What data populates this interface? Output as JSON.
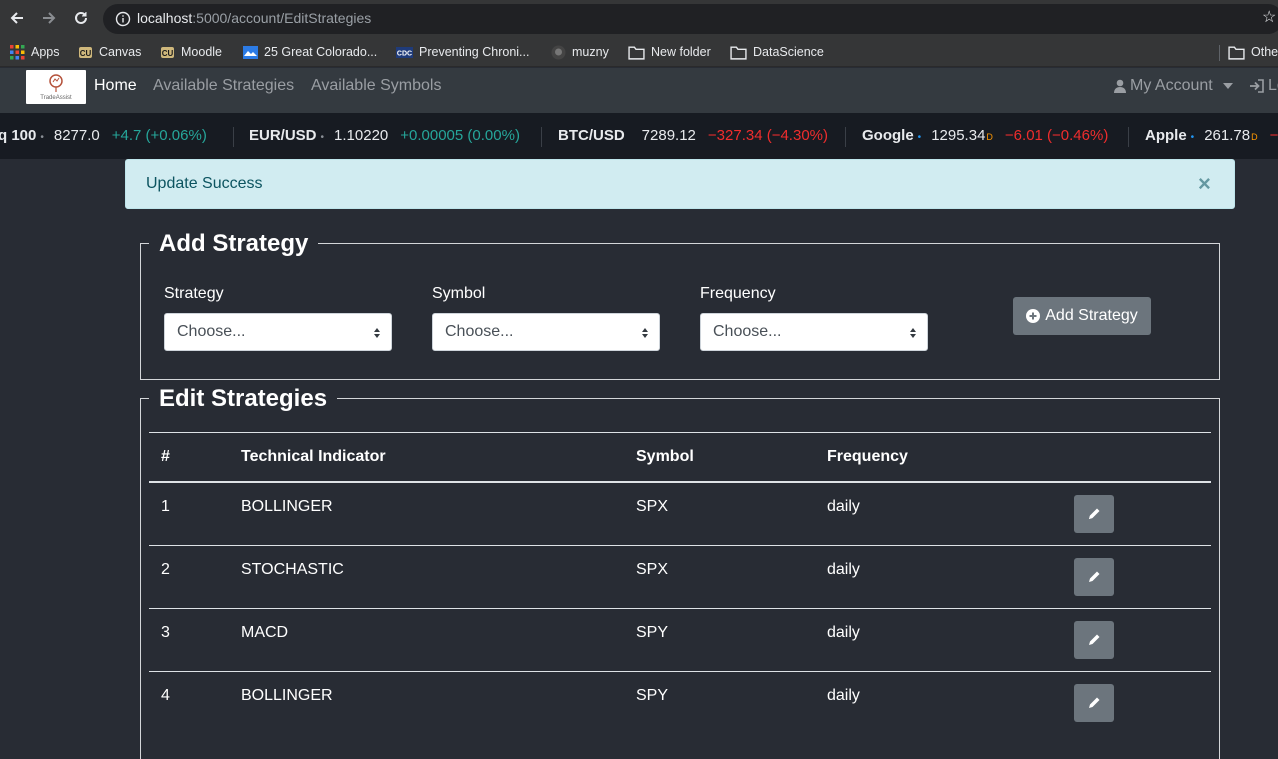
{
  "browser": {
    "url_host": "localhost",
    "url_path": ":5000/account/EditStrategies",
    "bookmarks": [
      {
        "label": "Apps",
        "icon": "apps-grid-icon"
      },
      {
        "label": "Canvas",
        "icon": "cu-logo-icon"
      },
      {
        "label": "Moodle",
        "icon": "cu-logo-icon"
      },
      {
        "label": "25 Great Colorado...",
        "icon": "site-favicon-icon"
      },
      {
        "label": "Preventing Chroni...",
        "icon": "cdc-favicon-icon"
      },
      {
        "label": "muzny",
        "icon": "github-icon"
      },
      {
        "label": "New folder",
        "icon": "folder-icon"
      },
      {
        "label": "DataScience",
        "icon": "folder-icon"
      },
      {
        "label": "Othe",
        "icon": "folder-icon"
      }
    ]
  },
  "navbar": {
    "links": [
      "Home",
      "Available Strategies",
      "Available Symbols"
    ],
    "account": "My Account",
    "logout": "Lo"
  },
  "ticker": [
    {
      "symbol": "q 100",
      "price": "8277.0",
      "change": "+4.7 (+0.06%)",
      "direction": "up",
      "dot": "•"
    },
    {
      "symbol": "EUR/USD",
      "price": "1.10220",
      "change": "+0.00005 (0.00%)",
      "direction": "up",
      "dot": "•"
    },
    {
      "symbol": "BTC/USD",
      "price": "7289.12",
      "change": "−327.34 (−4.30%)",
      "direction": "down",
      "dot": ""
    },
    {
      "symbol": "Google",
      "price": "1295.34",
      "sup": "D",
      "change": "−6.01 (−0.46%)",
      "direction": "down",
      "dot": "•"
    },
    {
      "symbol": "Apple",
      "price": "261.78",
      "sup": "D",
      "change": "",
      "direction": "down",
      "dot": "•"
    }
  ],
  "alert": {
    "message": "Update Success",
    "close": "×"
  },
  "add_strategy": {
    "title": "Add Strategy",
    "fields": [
      {
        "label": "Strategy",
        "value": "Choose..."
      },
      {
        "label": "Symbol",
        "value": "Choose..."
      },
      {
        "label": "Frequency",
        "value": "Choose..."
      }
    ],
    "button": "Add Strategy"
  },
  "edit_strategies": {
    "title": "Edit Strategies",
    "columns": [
      "#",
      "Technical Indicator",
      "Symbol",
      "Frequency"
    ],
    "rows": [
      {
        "num": "1",
        "indicator": "BOLLINGER",
        "symbol": "SPX",
        "frequency": "daily"
      },
      {
        "num": "2",
        "indicator": "STOCHASTIC",
        "symbol": "SPX",
        "frequency": "daily"
      },
      {
        "num": "3",
        "indicator": "MACD",
        "symbol": "SPY",
        "frequency": "daily"
      },
      {
        "num": "4",
        "indicator": "BOLLINGER",
        "symbol": "SPY",
        "frequency": "daily"
      }
    ]
  },
  "colors": {
    "page_bg": "#282c34",
    "navbar_bg": "#343a40",
    "ticker_bg": "#171b22",
    "alert_bg": "#d1ecf1",
    "alert_text": "#0c5460",
    "button_secondary": "#6c757d",
    "ticker_up": "#26a69a",
    "ticker_down": "#ef2d2d"
  }
}
